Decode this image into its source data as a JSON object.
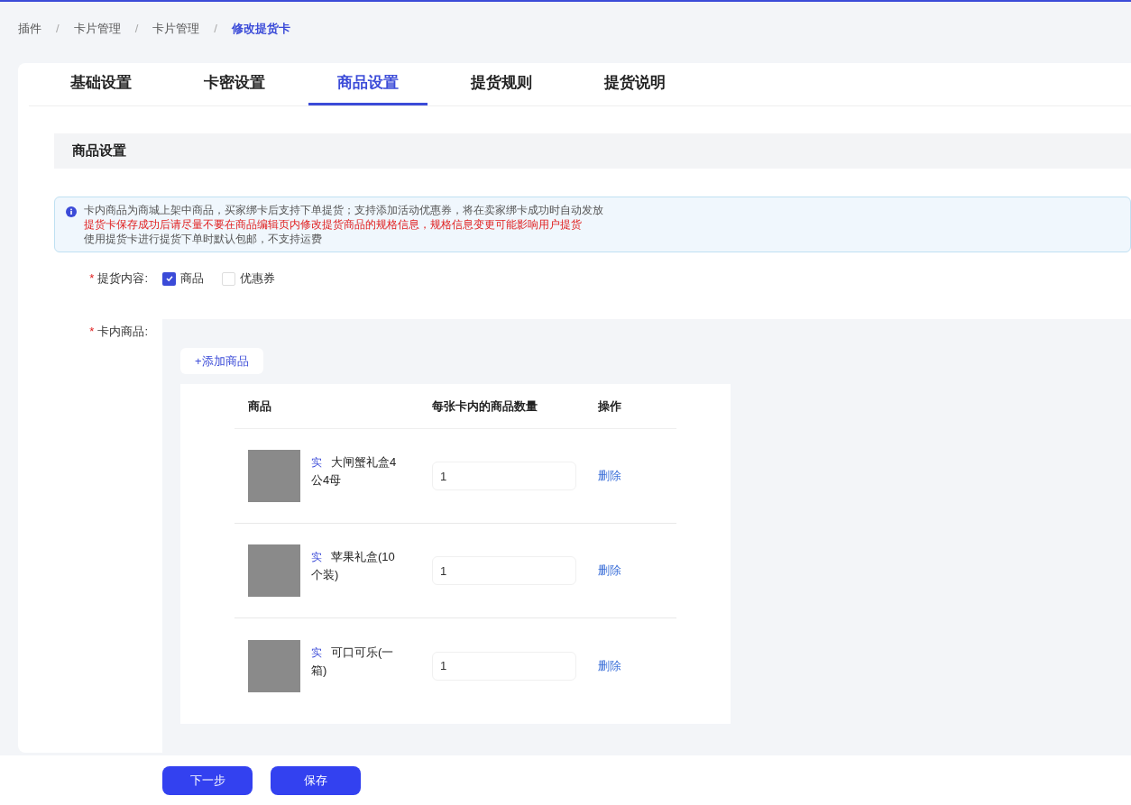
{
  "breadcrumb": [
    {
      "label": "插件",
      "selected": false
    },
    {
      "label": "卡片管理",
      "selected": false
    },
    {
      "label": "卡片管理",
      "selected": false
    },
    {
      "label": "修改提货卡",
      "selected": true
    }
  ],
  "breadcrumb_separator": "/",
  "tabs": [
    {
      "label": "基础设置",
      "selected": false
    },
    {
      "label": "卡密设置",
      "selected": false
    },
    {
      "label": "商品设置",
      "selected": true
    },
    {
      "label": "提货规则",
      "selected": false
    },
    {
      "label": "提货说明",
      "selected": false
    }
  ],
  "section_title": "商品设置",
  "notice": [
    {
      "text": "卡内商品为商城上架中商品，买家绑卡后支持下单提货；支持添加活动优惠券，将在卖家绑卡成功时自动发放",
      "kind": "info"
    },
    {
      "text": "提货卡保存成功后请尽量不要在商品编辑页内修改提货商品的规格信息，规格信息变更可能影响用户提货",
      "kind": "warning"
    },
    {
      "text": "使用提货卡进行提货下单时默认包邮，不支持运费",
      "kind": "info"
    }
  ],
  "content_field": {
    "label": "提货内容:",
    "required_mark": "*",
    "options": [
      {
        "label": "商品",
        "checked": true
      },
      {
        "label": "优惠券",
        "checked": false
      }
    ]
  },
  "products_field": {
    "label": "卡内商品:",
    "required_mark": "*",
    "add_button": "+添加商品",
    "columns": [
      "商品",
      "每张卡内的商品数量",
      "操作"
    ],
    "rows": [
      {
        "tag": "实",
        "name": "大闸蟹礼盒4公4母",
        "quantity": "1",
        "action": "删除"
      },
      {
        "tag": "实",
        "name": "苹果礼盒(10个装)",
        "quantity": "1",
        "action": "删除"
      },
      {
        "tag": "实",
        "name": "可口可乐(一箱)",
        "quantity": "1",
        "action": "删除"
      }
    ]
  },
  "footer_buttons": [
    "下一步",
    "保存"
  ]
}
